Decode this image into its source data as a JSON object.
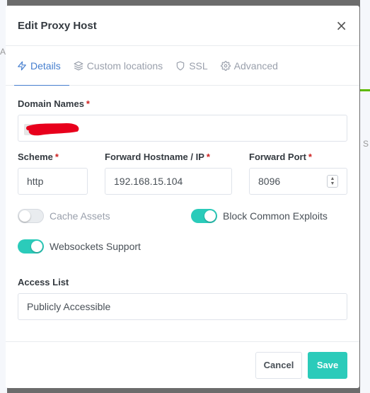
{
  "modal": {
    "title": "Edit Proxy Host",
    "close_glyph": "×"
  },
  "tabs": [
    {
      "label": "Details",
      "icon": "zap-icon",
      "active": true
    },
    {
      "label": "Custom locations",
      "icon": "layers-icon",
      "active": false
    },
    {
      "label": "SSL",
      "icon": "shield-icon",
      "active": false
    },
    {
      "label": "Advanced",
      "icon": "gear-icon",
      "active": false
    }
  ],
  "form": {
    "domain_names": {
      "label": "Domain Names",
      "required": "*",
      "value": ""
    },
    "scheme": {
      "label": "Scheme",
      "required": "*",
      "value": "http"
    },
    "forward_host": {
      "label": "Forward Hostname / IP",
      "required": "*",
      "value": "192.168.15.104"
    },
    "forward_port": {
      "label": "Forward Port",
      "required": "*",
      "value": "8096"
    },
    "cache_assets": {
      "label": "Cache Assets",
      "enabled": false
    },
    "block_exploits": {
      "label": "Block Common Exploits",
      "enabled": true
    },
    "websockets": {
      "label": "Websockets Support",
      "enabled": true
    },
    "access_list": {
      "label": "Access List",
      "value": "Publicly Accessible"
    }
  },
  "footer": {
    "cancel_label": "Cancel",
    "save_label": "Save"
  },
  "colors": {
    "accent": "#467fcf",
    "toggle_on": "#2bcbba",
    "required": "#cd201f",
    "redaction": "#e8001c"
  },
  "background": {
    "left_fragment": "Ac",
    "right_fragment": "S"
  }
}
